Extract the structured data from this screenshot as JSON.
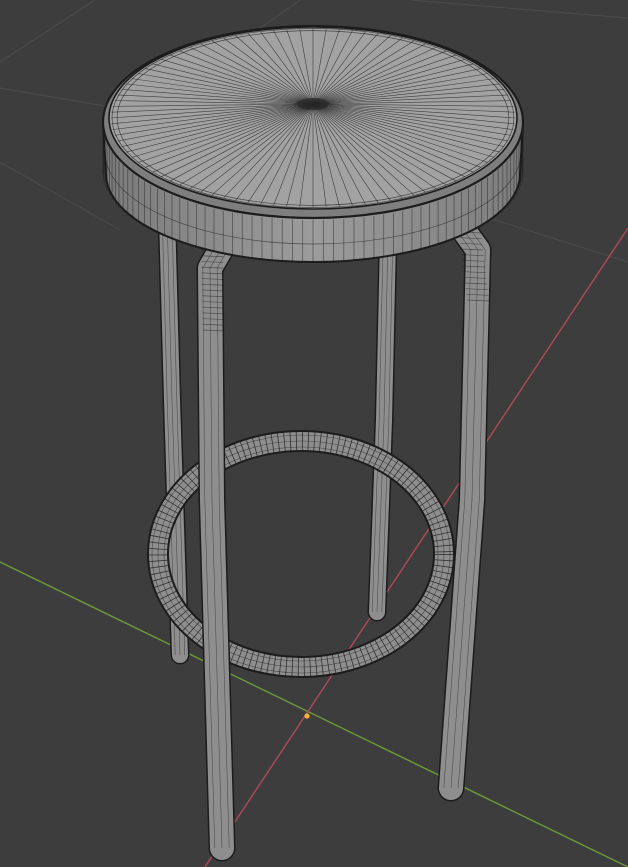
{
  "viewport": {
    "background": "#3d3d3d",
    "grid_color": "#4a4a4a",
    "x_axis_color": "#b0495a",
    "y_axis_color": "#6f9a3a",
    "origin_color": "#f2b232"
  },
  "model": {
    "object": "stool",
    "shading": "solid-gray-with-wireframe-overlay",
    "surface_color": "#8e8e8e",
    "wire_color": "#1c1c1c",
    "parts": [
      "seat",
      "front-left-leg",
      "front-right-leg",
      "back-left-leg",
      "back-right-leg",
      "footrest-ring"
    ]
  }
}
